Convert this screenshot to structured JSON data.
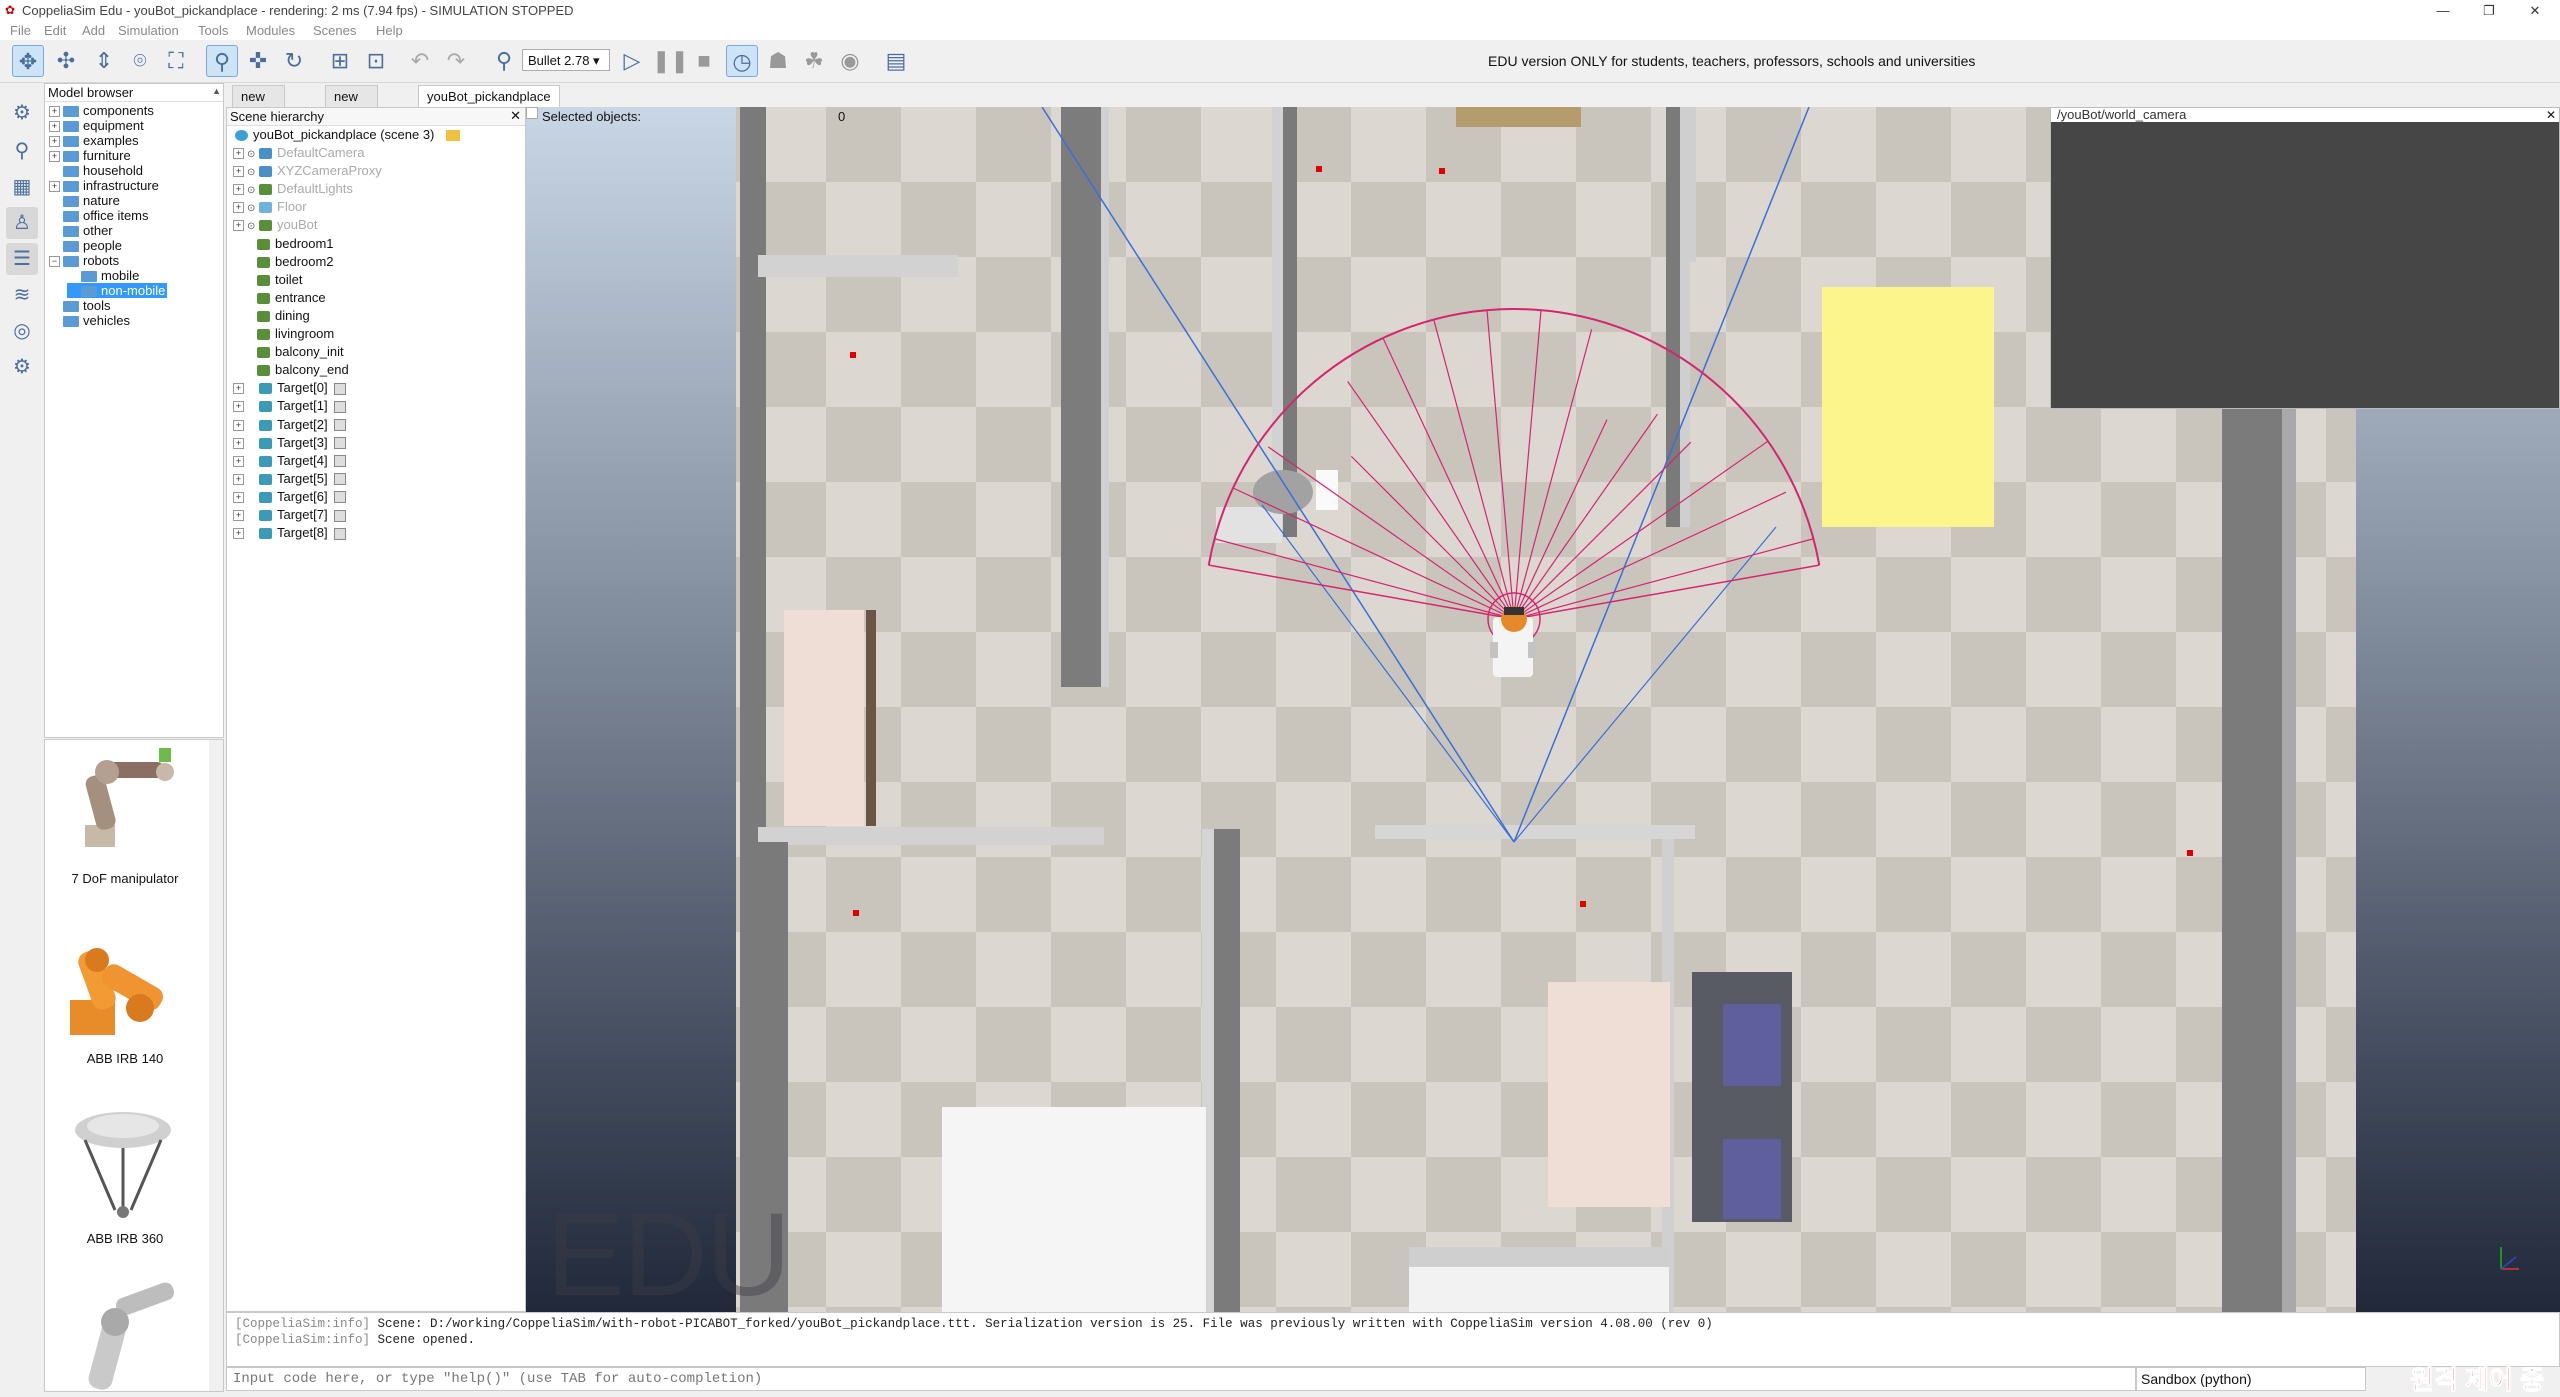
{
  "window": {
    "title": "CoppeliaSim Edu - youBot_pickandplace - rendering: 2 ms (7.94 fps) - SIMULATION STOPPED"
  },
  "menu": [
    "File",
    "Edit",
    "Add",
    "Simulation",
    "Tools",
    "Modules",
    "Scenes",
    "Help"
  ],
  "toolbar": {
    "engine": "Bullet 2.78",
    "notice": "EDU version ONLY for students, teachers, professors, schools and universities"
  },
  "model_browser": {
    "title": "Model browser",
    "items": [
      {
        "label": "components",
        "expandable": true
      },
      {
        "label": "equipment",
        "expandable": true
      },
      {
        "label": "examples",
        "expandable": true
      },
      {
        "label": "furniture",
        "expandable": true
      },
      {
        "label": "household",
        "expandable": false
      },
      {
        "label": "infrastructure",
        "expandable": true
      },
      {
        "label": "nature",
        "expandable": false
      },
      {
        "label": "office items",
        "expandable": false
      },
      {
        "label": "other",
        "expandable": false
      },
      {
        "label": "people",
        "expandable": false
      },
      {
        "label": "robots",
        "expandable": true
      },
      {
        "label": "mobile",
        "expandable": false
      },
      {
        "label": "non-mobile",
        "expandable": false,
        "selected": true
      },
      {
        "label": "tools",
        "expandable": false
      },
      {
        "label": "vehicles",
        "expandable": false
      }
    ],
    "thumbnails": [
      "7 DoF manipulator",
      "ABB IRB 140",
      "ABB IRB 360",
      ""
    ]
  },
  "tabs": [
    "new scene",
    "new scene",
    "youBot_pickandplace"
  ],
  "hierarchy": {
    "title": "Scene hierarchy",
    "root": "youBot_pickandplace (scene 3)",
    "objects": [
      {
        "label": "DefaultCamera",
        "dim": true
      },
      {
        "label": "XYZCameraProxy",
        "dim": true
      },
      {
        "label": "DefaultLights",
        "dim": true
      },
      {
        "label": "Floor",
        "dim": true
      },
      {
        "label": "youBot",
        "dim": true
      },
      {
        "label": "bedroom1",
        "dim": false
      },
      {
        "label": "bedroom2",
        "dim": false
      },
      {
        "label": "toilet",
        "dim": false
      },
      {
        "label": "entrance",
        "dim": false
      },
      {
        "label": "dining",
        "dim": false
      },
      {
        "label": "livingroom",
        "dim": false
      },
      {
        "label": "balcony_init",
        "dim": false
      },
      {
        "label": "balcony_end",
        "dim": false
      },
      {
        "label": "Target[0]",
        "dim": false
      },
      {
        "label": "Target[1]",
        "dim": false
      },
      {
        "label": "Target[2]",
        "dim": false
      },
      {
        "label": "Target[3]",
        "dim": false
      },
      {
        "label": "Target[4]",
        "dim": false
      },
      {
        "label": "Target[5]",
        "dim": false
      },
      {
        "label": "Target[6]",
        "dim": false
      },
      {
        "label": "Target[7]",
        "dim": false
      },
      {
        "label": "Target[8]",
        "dim": false
      }
    ]
  },
  "viewport": {
    "selected_label": "Selected objects:",
    "selected_count": "0",
    "camera_view_title": "/youBot/world_camera",
    "watermark": "EDU"
  },
  "console": {
    "lines": [
      {
        "tag": "[CoppeliaSim:info]",
        "text": "Scene: D:/working/CoppeliaSim/with-robot-PICABOT_forked/youBot_pickandplace.ttt. Serialization version is 25. File was previously written with CoppeliaSim version 4.08.00 (rev 0)"
      },
      {
        "tag": "[CoppeliaSim:info]",
        "text": "Scene opened."
      }
    ],
    "input_placeholder": "Input code here, or type \"help()\" (use TAB for auto-completion)",
    "sandbox": "Sandbox (python)"
  },
  "overlay_remote": "원격 제어 중",
  "colors": {
    "selection": "#3399ff",
    "sensor": "#d6246e",
    "ray": "#3a6fd8",
    "target": "#ff0000"
  }
}
